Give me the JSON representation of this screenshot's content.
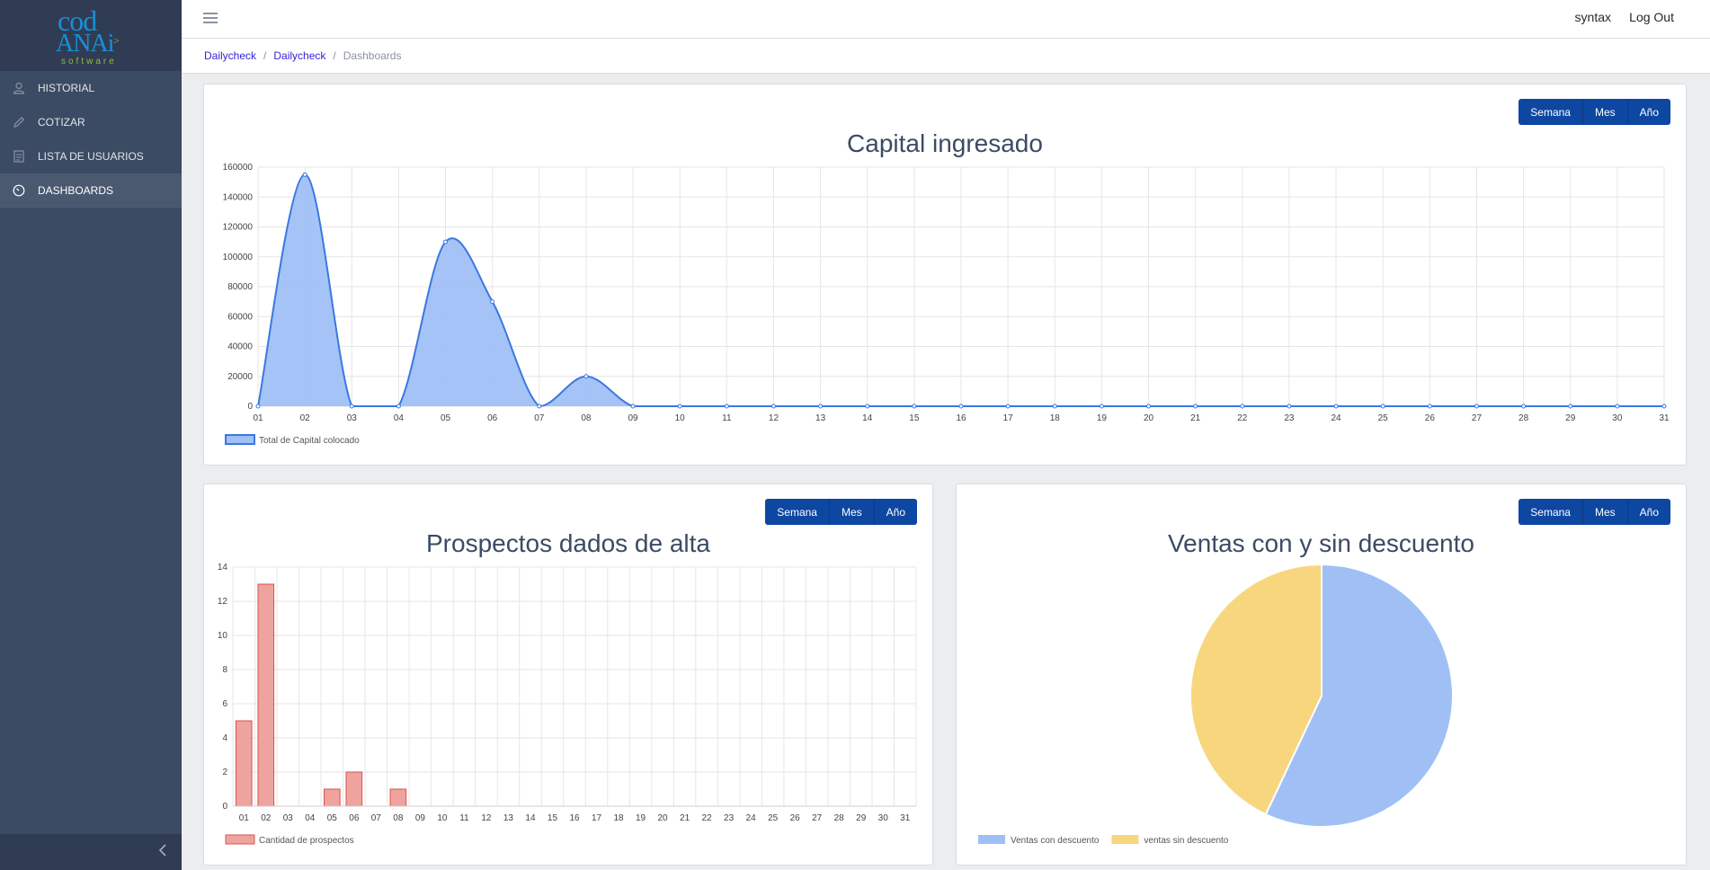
{
  "brand": {
    "line1": "cod",
    "line2": "ANAi",
    "line3": "software"
  },
  "sidebar": {
    "items": [
      {
        "label": "HISTORIAL",
        "icon": "user-icon"
      },
      {
        "label": "COTIZAR",
        "icon": "pencil-icon"
      },
      {
        "label": "LISTA DE USUARIOS",
        "icon": "list-icon"
      },
      {
        "label": "DASHBOARDS",
        "icon": "speedometer-icon",
        "active": true
      }
    ]
  },
  "header": {
    "user": "syntax",
    "logout": "Log Out"
  },
  "breadcrumb": {
    "items": [
      "Dailycheck",
      "Dailycheck"
    ],
    "current": "Dashboards"
  },
  "period_buttons": [
    "Semana",
    "Mes",
    "Año"
  ],
  "charts": {
    "capital": {
      "title": "Capital ingresado"
    },
    "prospectos": {
      "title": "Prospectos dados de alta"
    },
    "ventas": {
      "title": "Ventas con y sin descuento"
    }
  },
  "colors": {
    "blue_fill": "#a0c0f5",
    "blue_line": "#3a78e0",
    "red_fill": "#eea39f",
    "red_line": "#d9534f",
    "yellow": "#f7d67e",
    "button": "#0d47a1"
  },
  "chart_data": [
    {
      "type": "area",
      "title": "Capital ingresado",
      "x": [
        "01",
        "02",
        "03",
        "04",
        "05",
        "06",
        "07",
        "08",
        "09",
        "10",
        "11",
        "12",
        "13",
        "14",
        "15",
        "16",
        "17",
        "18",
        "19",
        "20",
        "21",
        "22",
        "23",
        "24",
        "25",
        "26",
        "27",
        "28",
        "29",
        "30",
        "31"
      ],
      "series": [
        {
          "name": "Total de Capital colocado",
          "values": [
            0,
            155000,
            0,
            0,
            110000,
            70000,
            0,
            20000,
            0,
            0,
            0,
            0,
            0,
            0,
            0,
            0,
            0,
            0,
            0,
            0,
            0,
            0,
            0,
            0,
            0,
            0,
            0,
            0,
            0,
            0,
            0
          ]
        }
      ],
      "ylim": [
        0,
        160000
      ],
      "yticks": [
        0,
        20000,
        40000,
        60000,
        80000,
        100000,
        120000,
        140000,
        160000
      ],
      "grid": true,
      "legend": "bottom-left"
    },
    {
      "type": "bar",
      "title": "Prospectos dados de alta",
      "x": [
        "01",
        "02",
        "03",
        "04",
        "05",
        "06",
        "07",
        "08",
        "09",
        "10",
        "11",
        "12",
        "13",
        "14",
        "15",
        "16",
        "17",
        "18",
        "19",
        "20",
        "21",
        "22",
        "23",
        "24",
        "25",
        "26",
        "27",
        "28",
        "29",
        "30",
        "31"
      ],
      "series": [
        {
          "name": "Cantidad de prospectos",
          "values": [
            5,
            13,
            0,
            0,
            1,
            2,
            0,
            1,
            0,
            0,
            0,
            0,
            0,
            0,
            0,
            0,
            0,
            0,
            0,
            0,
            0,
            0,
            0,
            0,
            0,
            0,
            0,
            0,
            0,
            0,
            0
          ]
        }
      ],
      "ylim": [
        0,
        14
      ],
      "yticks": [
        0,
        2,
        4,
        6,
        8,
        10,
        12,
        14
      ],
      "grid": true,
      "legend": "bottom-left"
    },
    {
      "type": "pie",
      "title": "Ventas con y sin descuento",
      "labels": [
        "Ventas con descuento",
        "ventas sin descuento"
      ],
      "values": [
        57,
        43
      ],
      "legend": "bottom-left"
    }
  ]
}
